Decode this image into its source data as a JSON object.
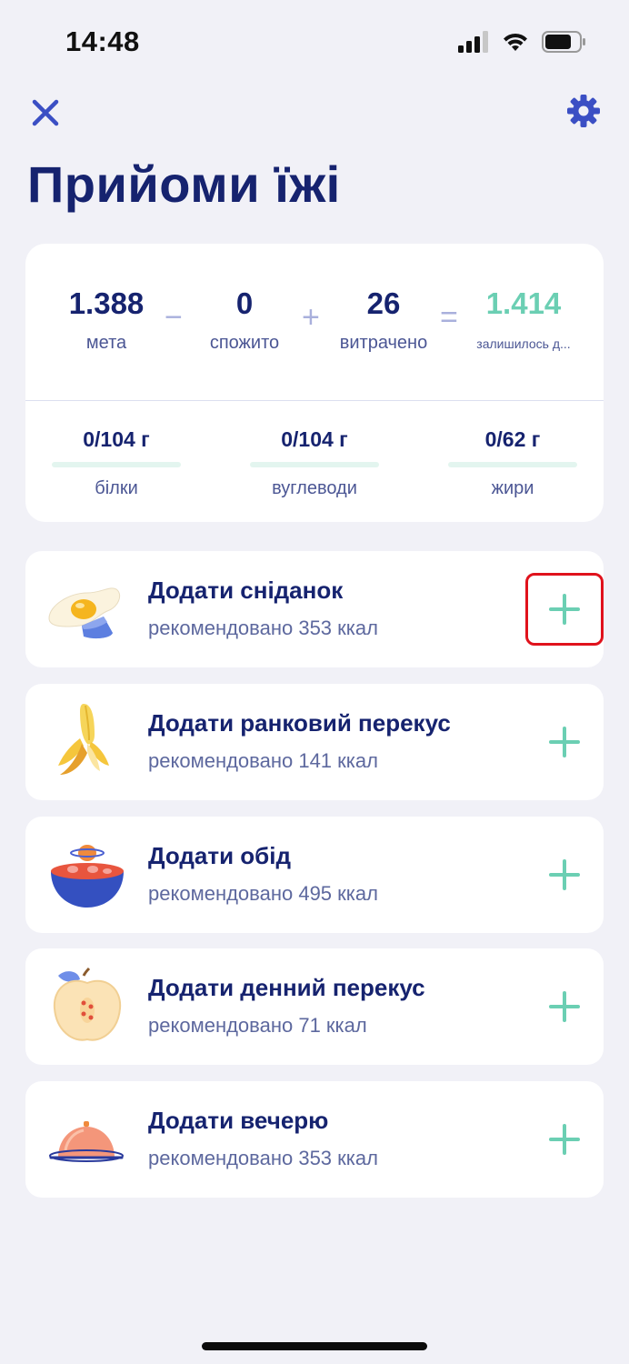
{
  "status_bar": {
    "time": "14:48"
  },
  "header": {
    "title": "Прийоми їжі"
  },
  "summary": {
    "goal": {
      "value": "1.388",
      "label": "мета"
    },
    "consumed": {
      "value": "0",
      "label": "спожито"
    },
    "burned": {
      "value": "26",
      "label": "витрачено"
    },
    "remaining": {
      "value": "1.414",
      "label": "залишилось д..."
    },
    "operators": {
      "minus": "−",
      "plus": "+",
      "equals": "="
    }
  },
  "macros": [
    {
      "value": "0/104 г",
      "label": "білки",
      "progress": 0
    },
    {
      "value": "0/104 г",
      "label": "вуглеводи",
      "progress": 0
    },
    {
      "value": "0/62 г",
      "label": "жири",
      "progress": 0
    }
  ],
  "meals": [
    {
      "title": "Додати сніданок",
      "subtitle": "рекомендовано 353 ккал",
      "icon": "egg-icon"
    },
    {
      "title": "Додати ранковий перекус",
      "subtitle": "рекомендовано 141 ккал",
      "icon": "banana-icon"
    },
    {
      "title": "Додати обід",
      "subtitle": "рекомендовано 495 ккал",
      "icon": "bowl-icon"
    },
    {
      "title": "Додати денний перекус",
      "subtitle": "рекомендовано 71 ккал",
      "icon": "apple-icon"
    },
    {
      "title": "Додати вечерю",
      "subtitle": "рекомендовано 353 ккал",
      "icon": "cloche-icon"
    }
  ],
  "colors": {
    "accent": "#6bcfb3",
    "primary": "#16236f",
    "highlight": "#e0121c"
  }
}
